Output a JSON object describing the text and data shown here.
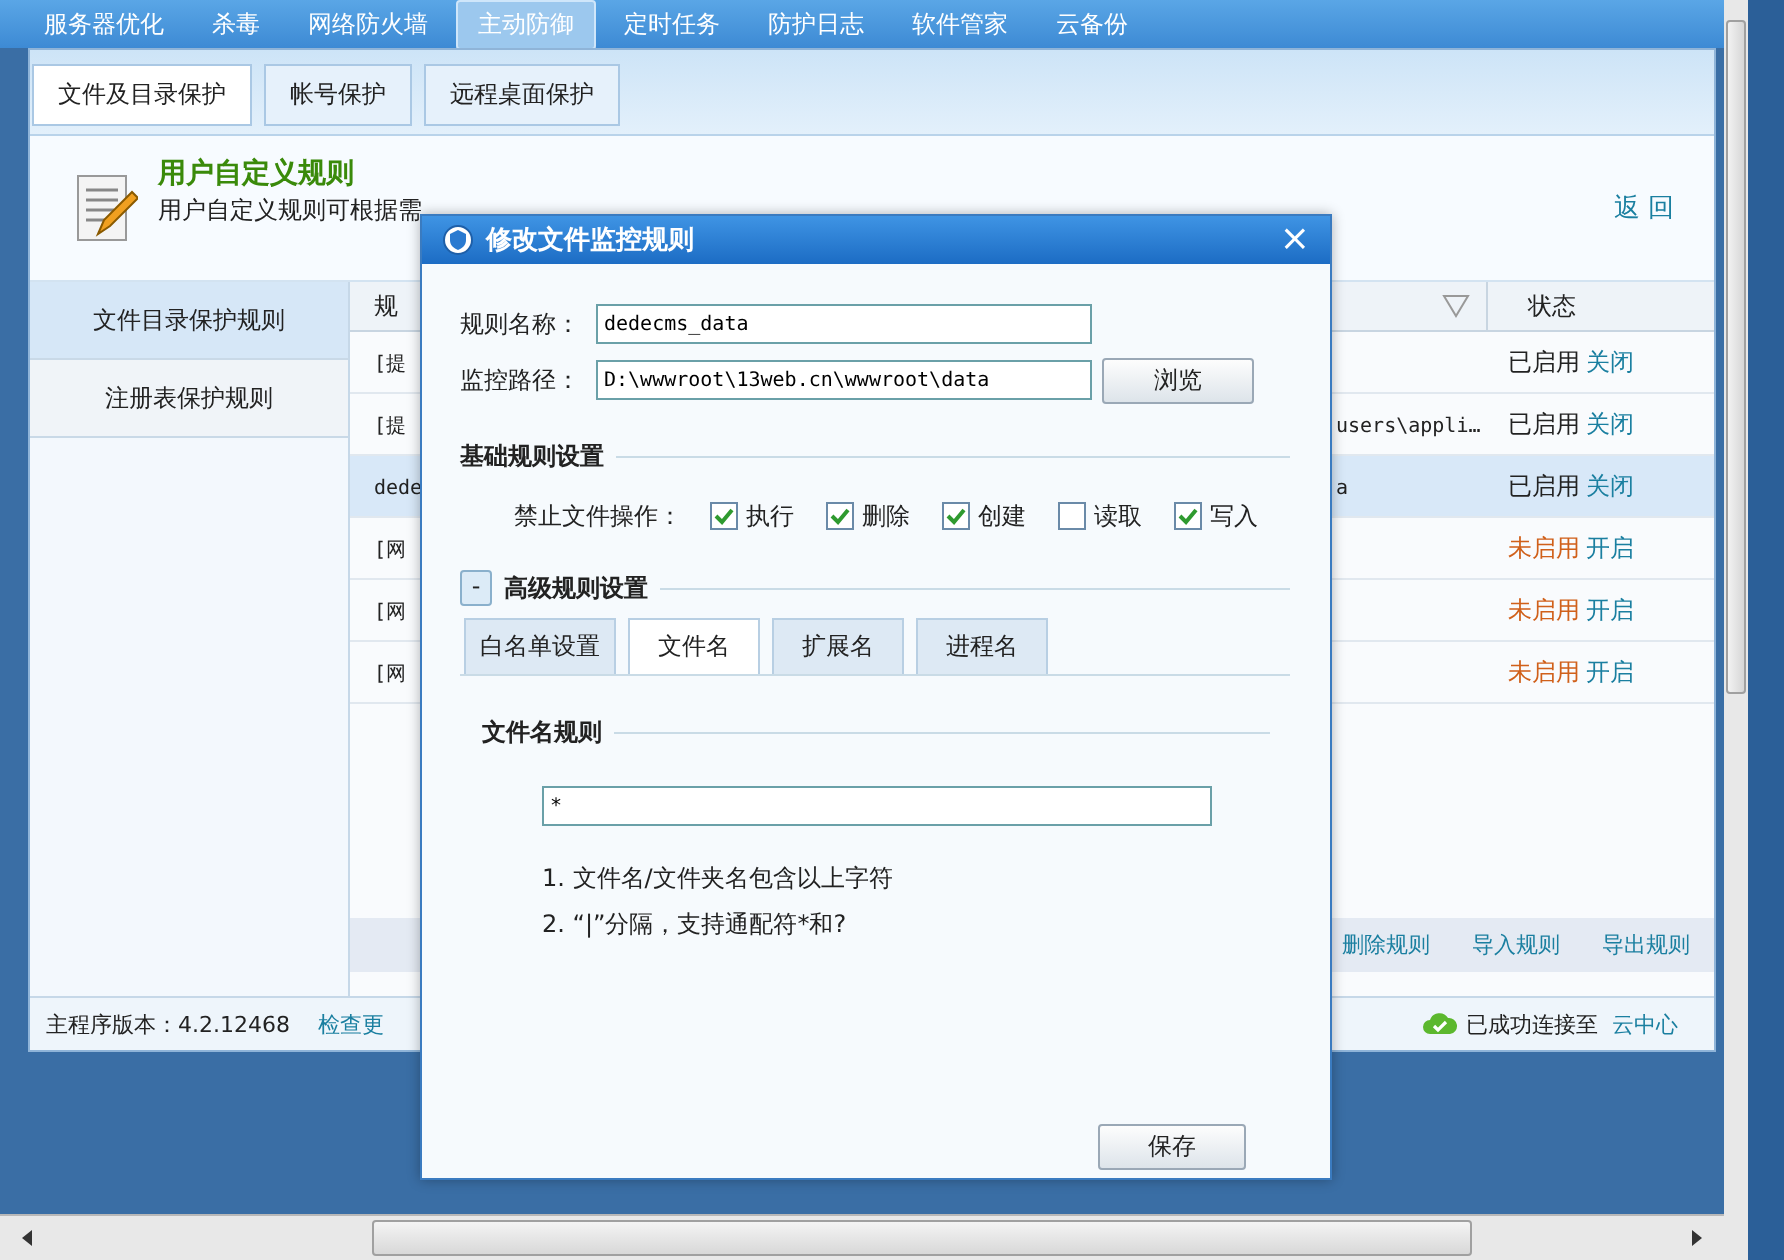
{
  "nav": [
    {
      "label": "服务器优化",
      "selected": false
    },
    {
      "label": "杀毒",
      "selected": false
    },
    {
      "label": "网络防火墙",
      "selected": false
    },
    {
      "label": "主动防御",
      "selected": true
    },
    {
      "label": "定时任务",
      "selected": false
    },
    {
      "label": "防护日志",
      "selected": false
    },
    {
      "label": "软件管家",
      "selected": false
    },
    {
      "label": "云备份",
      "selected": false
    }
  ],
  "subtabs": [
    {
      "label": "文件及目录保护",
      "selected": true
    },
    {
      "label": "帐号保护",
      "selected": false
    },
    {
      "label": "远程桌面保护",
      "selected": false
    }
  ],
  "header": {
    "title": "用户自定义规则",
    "description": "用户自定义规则可根据需",
    "back": "返 回"
  },
  "sidebar": {
    "items": [
      {
        "label": "文件目录保护规则",
        "selected": true
      },
      {
        "label": "注册表保护规则",
        "selected": false
      }
    ]
  },
  "table": {
    "columns": [
      "规",
      "状态"
    ],
    "rows": [
      {
        "name": "[提",
        "path": "",
        "status": "已启用",
        "enabled": true,
        "action": "关闭",
        "selected": false
      },
      {
        "name": "[提",
        "path": "users\\appli…",
        "status": "已启用",
        "enabled": true,
        "action": "关闭",
        "selected": false
      },
      {
        "name": "dede",
        "path": "a",
        "status": "已启用",
        "enabled": true,
        "action": "关闭",
        "selected": true
      },
      {
        "name": "[网",
        "path": "",
        "status": "未启用",
        "enabled": false,
        "action": "开启",
        "selected": false
      },
      {
        "name": "[网",
        "path": "",
        "status": "未启用",
        "enabled": false,
        "action": "开启",
        "selected": false
      },
      {
        "name": "[网",
        "path": "",
        "status": "未启用",
        "enabled": false,
        "action": "开启",
        "selected": false
      }
    ]
  },
  "actions": [
    "删除规则",
    "导入规则",
    "导出规则"
  ],
  "status_bar": {
    "version": "主程序版本：4.2.12468",
    "update": "检查更",
    "connection": "已成功连接至",
    "cloud": "云中心"
  },
  "dialog": {
    "title": "修改文件监控规则",
    "close": "×",
    "fields": [
      {
        "label": "规则名称：",
        "value": "dedecms_data"
      },
      {
        "label": "监控路径：",
        "value": "D:\\wwwroot\\13web.cn\\wwwroot\\data",
        "button": "浏览"
      }
    ],
    "basic_title": "基础规则设置",
    "forbid_label": "禁止文件操作：",
    "operations": [
      {
        "label": "执行",
        "checked": true
      },
      {
        "label": "删除",
        "checked": true
      },
      {
        "label": "创建",
        "checked": true
      },
      {
        "label": "读取",
        "checked": false
      },
      {
        "label": "写入",
        "checked": true
      }
    ],
    "advanced_toggle": "-",
    "advanced_title": "高级规则设置",
    "tabs": [
      {
        "label": "白名单设置",
        "selected": false
      },
      {
        "label": "文件名",
        "selected": true
      },
      {
        "label": "扩展名",
        "selected": false
      },
      {
        "label": "进程名",
        "selected": false
      }
    ],
    "rule_title": "文件名规则",
    "rule_value": "*",
    "notes": [
      "1. 文件名/文件夹名包含以上字符",
      "2. “|”分隔，支持通配符*和?"
    ],
    "save": "保存"
  }
}
